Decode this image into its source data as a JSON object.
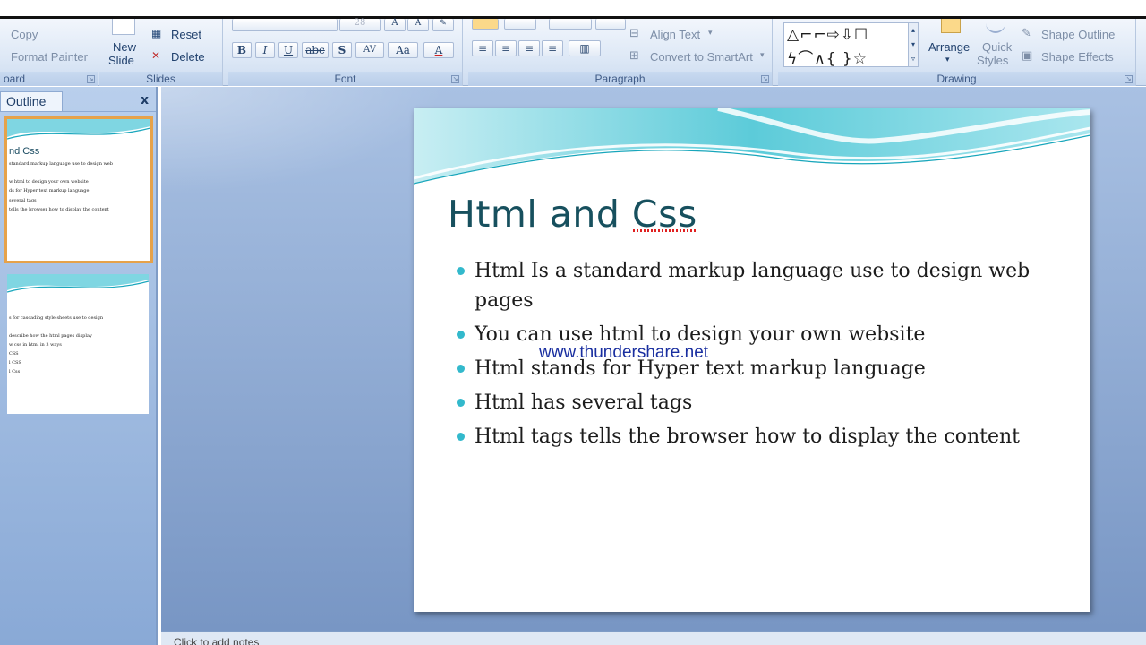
{
  "ribbon": {
    "clipboard": {
      "copy": "Copy",
      "format_painter": "Format Painter",
      "label": "oard"
    },
    "slides": {
      "new_slide": "New",
      "new_slide_2": "Slide",
      "reset": "Reset",
      "delete": "Delete",
      "label": "Slides"
    },
    "font": {
      "size": "28",
      "bold": "B",
      "italic": "I",
      "underline": "U",
      "strike": "abc",
      "shadow": "S",
      "spacing": "AV",
      "case": "Aa",
      "color": "A",
      "label": "Font"
    },
    "paragraph": {
      "align_text": "Align Text",
      "convert_smartart": "Convert to SmartArt",
      "label": "Paragraph"
    },
    "drawing": {
      "arrange": "Arrange",
      "quick": "Quick",
      "styles": "Styles",
      "shape_outline": "Shape Outline",
      "shape_effects": "Shape Effects",
      "label": "Drawing"
    }
  },
  "left_pane": {
    "tab": "Outline",
    "close": "x",
    "thumb1": {
      "title": "nd Css",
      "lines": [
        "standard markup language use to design web",
        "w html to design your own website",
        "ds for Hyper text markup language",
        "several tags",
        "tells the browser how to display the content"
      ]
    },
    "thumb2": {
      "lines": [
        "s for cascading style sheets use to design",
        "describe how the html pages display",
        "w css in html in 3 ways",
        "CSS",
        "l CSS",
        "l Css"
      ]
    }
  },
  "slide": {
    "title": "Html and Css",
    "bullets": [
      "Html Is a standard markup language use to design web pages",
      "You can use html to design your own website",
      "Html stands for Hyper text markup language",
      "Html has several tags",
      "Html tags tells the browser how to display the content"
    ]
  },
  "watermark": "www.thundershare.net",
  "notes": {
    "placeholder": "Click to add notes"
  },
  "colors": {
    "title": "#17505e",
    "bullet": "#33b9cc",
    "wave": "#5ccbd9"
  }
}
